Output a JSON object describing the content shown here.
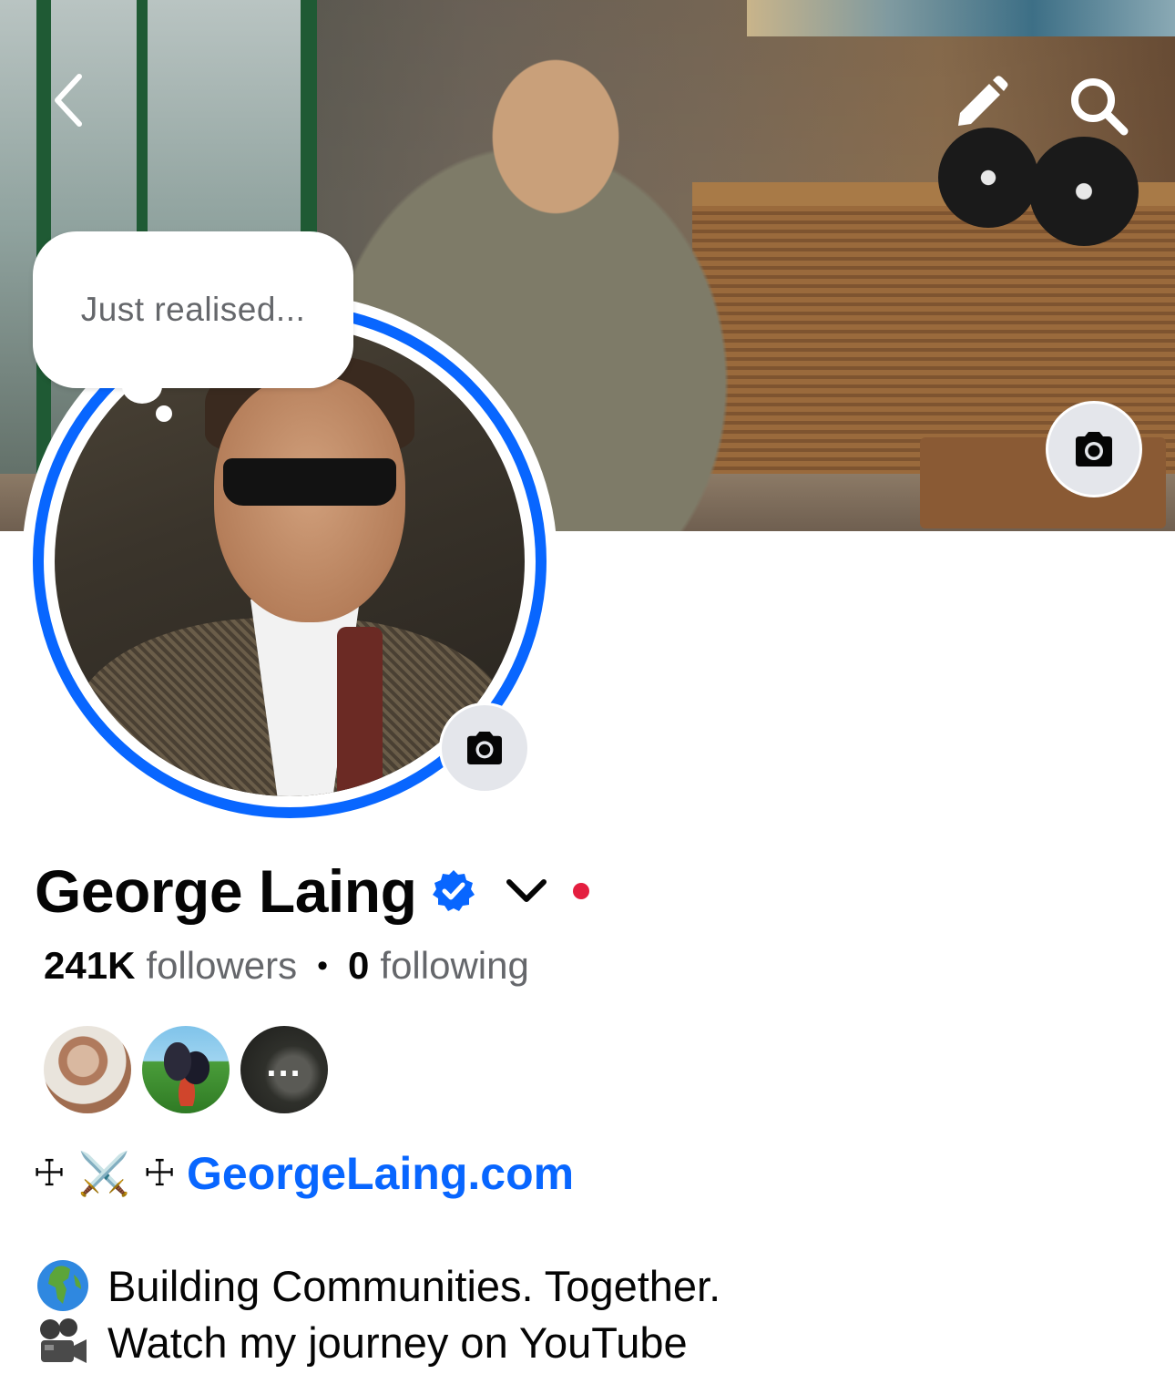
{
  "header": {
    "back_icon": "chevron-left-icon",
    "edit_icon": "pencil-icon",
    "search_icon": "search-icon",
    "cover_camera_icon": "camera-icon"
  },
  "profile": {
    "note": "Just realised...",
    "name": "George Laing",
    "verified": true,
    "accent_color": "#0866ff",
    "status_dot_color": "#e41e3f",
    "followers_count": "241K",
    "followers_label": "followers",
    "following_count": "0",
    "following_label": "following",
    "mutual_more": "..."
  },
  "bio": {
    "decor_left": "☩",
    "swords": "⚔️",
    "decor_right": "☩",
    "website": "GeorgeLaing.com",
    "line1": "Building Communities. Together.",
    "line2": "Watch my journey on YouTube"
  }
}
